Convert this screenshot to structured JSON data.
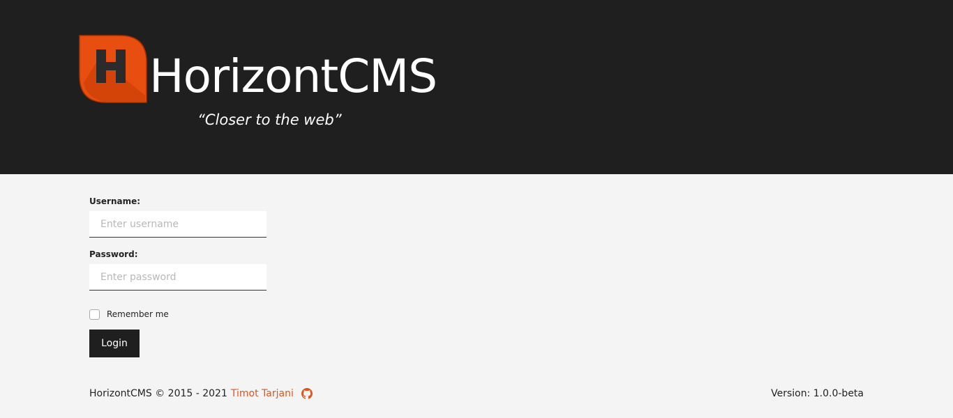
{
  "brand": {
    "name": "HorizontCMS",
    "tagline": "“Closer to the web”",
    "accent_color": "#e0541e",
    "logo_letter": "H",
    "logo_icon": "horizontcms-logo-icon"
  },
  "form": {
    "username_label": "Username:",
    "username_placeholder": "Enter username",
    "username_value": "",
    "password_label": "Password:",
    "password_placeholder": "Enter password",
    "password_value": "",
    "remember_label": "Remember me",
    "remember_checked": false,
    "login_label": "Login"
  },
  "footer": {
    "copyright": "HorizontCMS © 2015 - 2021",
    "author": "Timot Tarjani",
    "github_icon": "github-icon",
    "version": "Version: 1.0.0-beta"
  }
}
